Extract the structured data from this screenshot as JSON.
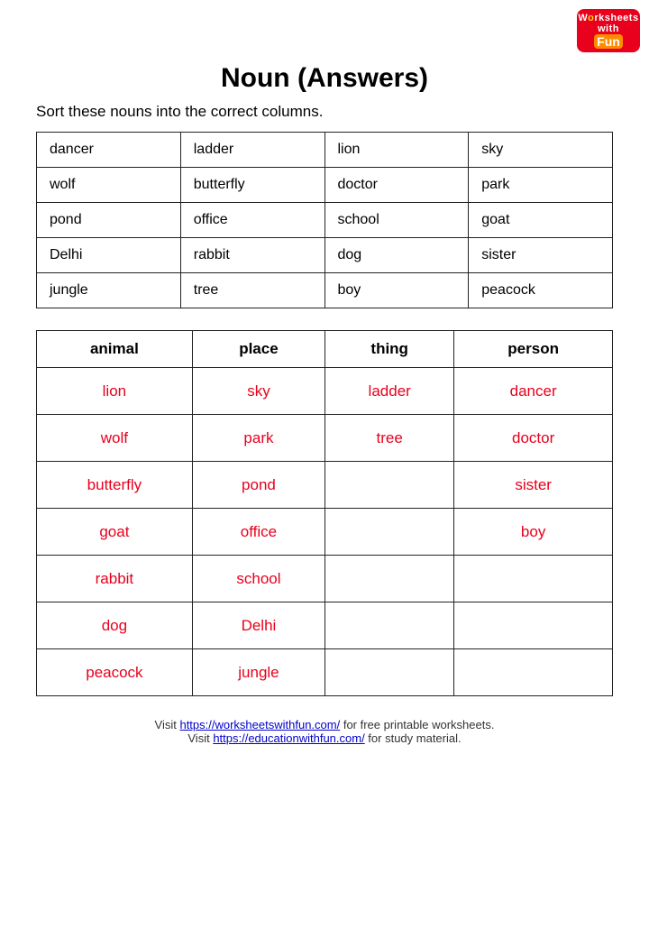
{
  "page": {
    "title": "Noun (Answers)",
    "subtitle": "Sort these nouns into the correct columns.",
    "logo": {
      "line1": "Worksheets",
      "line2": "with",
      "fun": "Fun"
    },
    "top_table": {
      "rows": [
        [
          "dancer",
          "ladder",
          "lion",
          "sky"
        ],
        [
          "wolf",
          "butterfly",
          "doctor",
          "park"
        ],
        [
          "pond",
          "office",
          "school",
          "goat"
        ],
        [
          "Delhi",
          "rabbit",
          "dog",
          "sister"
        ],
        [
          "jungle",
          "tree",
          "boy",
          "peacock"
        ]
      ]
    },
    "answer_table": {
      "headers": [
        "animal",
        "place",
        "thing",
        "person"
      ],
      "rows": [
        [
          "lion",
          "sky",
          "ladder",
          "dancer"
        ],
        [
          "wolf",
          "park",
          "tree",
          "doctor"
        ],
        [
          "butterfly",
          "pond",
          "",
          "sister"
        ],
        [
          "goat",
          "office",
          "",
          "boy"
        ],
        [
          "rabbit",
          "school",
          "",
          ""
        ],
        [
          "dog",
          "Delhi",
          "",
          ""
        ],
        [
          "peacock",
          "jungle",
          "",
          ""
        ]
      ]
    },
    "footer": {
      "line1_text": "Visit ",
      "line1_link": "https://worksheetswithfun.com/",
      "line1_link_label": "https://worksheetswithfun.com/",
      "line1_suffix": " for free printable worksheets.",
      "line2_text": "Visit ",
      "line2_link": "https://educationwithfun.com/",
      "line2_link_label": "https://educationwithfun.com/",
      "line2_suffix": " for study material."
    }
  }
}
